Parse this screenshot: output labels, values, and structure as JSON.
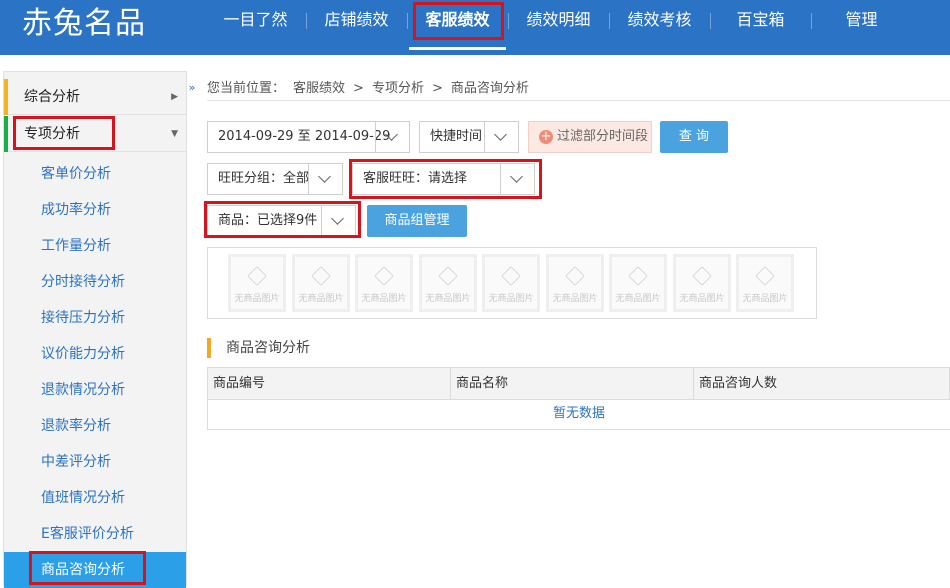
{
  "brand": {
    "logo": "赤兔名品"
  },
  "nav": [
    "一目了然",
    "店铺绩效",
    "客服绩效",
    "绩效明细",
    "绩效考核",
    "百宝箱",
    "管理"
  ],
  "nav_active": "客服绩效",
  "sidebar": {
    "groups": [
      {
        "label": "综合分析",
        "accent": "#f5b324"
      },
      {
        "label": "专项分析",
        "accent": "#19b04c"
      }
    ],
    "items": [
      "客单价分析",
      "成功率分析",
      "工作量分析",
      "分时接待分析",
      "接待压力分析",
      "议价能力分析",
      "退款情况分析",
      "退款率分析",
      "中差评分析",
      "值班情况分析",
      "E客服评价分析",
      "商品咨询分析"
    ],
    "active_item": "商品咨询分析"
  },
  "breadcrumb": {
    "prefix": "您当前位置：",
    "items": [
      "客服绩效",
      "专项分析",
      "商品咨询分析"
    ],
    "separator": ">"
  },
  "filters": {
    "date_range": "2014-09-29 至 2014-09-29",
    "quick_time": "快捷时间",
    "filter_time_button": "过滤部分时间段",
    "query_button": "查 询",
    "wangwang_group": "旺旺分组：全部",
    "cs_wangwang": "客服旺旺：请选择",
    "product": "商品：已选择9件",
    "product_group_button": "商品组管理"
  },
  "product_thumbs": [
    "无商品图片",
    "无商品图片",
    "无商品图片",
    "无商品图片",
    "无商品图片",
    "无商品图片",
    "无商品图片",
    "无商品图片",
    "无商品图片"
  ],
  "section": {
    "title": "商品咨询分析"
  },
  "table": {
    "columns": [
      "商品编号",
      "商品名称",
      "商品咨询人数"
    ],
    "empty_text": "暂无数据"
  },
  "colors": {
    "topbar": "#2b73c4",
    "accent_blue": "#4aa3df",
    "highlight": "#d9131b"
  }
}
